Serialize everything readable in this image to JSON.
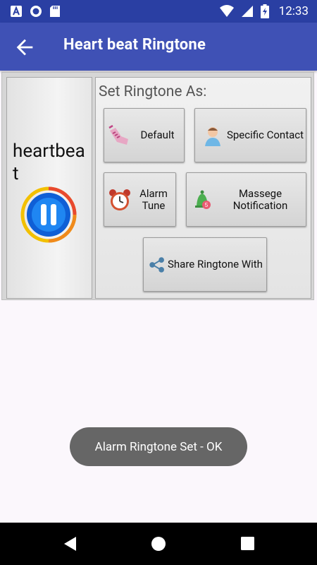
{
  "status_bar": {
    "time": "12:33",
    "icons": [
      "text-a-icon",
      "record-icon",
      "sd-card-icon",
      "wifi-icon",
      "signal-icon",
      "battery-charging-icon"
    ]
  },
  "app_bar": {
    "title": "Heart beat Ringtone",
    "back_icon": "arrow-back-icon"
  },
  "ringtone": {
    "name": "heartbeat",
    "play_icon": "pause-icon"
  },
  "set_as": {
    "label": "Set Ringtone As:",
    "buttons": [
      {
        "label": "Default",
        "icon": "phone-icon"
      },
      {
        "label": "Specific Contact",
        "icon": "contact-icon"
      },
      {
        "label": "Alarm Tune",
        "icon": "alarm-clock-icon"
      },
      {
        "label": "Massege Notification",
        "icon": "notification-bell-icon"
      },
      {
        "label": "Share Ringtone With",
        "icon": "share-icon"
      }
    ]
  },
  "toast": {
    "text": "Alarm Ringtone Set - OK"
  },
  "nav_bar": {
    "icons": [
      "back-triangle-icon",
      "home-circle-icon",
      "recents-square-icon"
    ]
  },
  "colors": {
    "status_bar": "#2a3fa3",
    "app_bar": "#3f51b5",
    "toast_bg": "#666666",
    "nav_bar": "#000000"
  }
}
